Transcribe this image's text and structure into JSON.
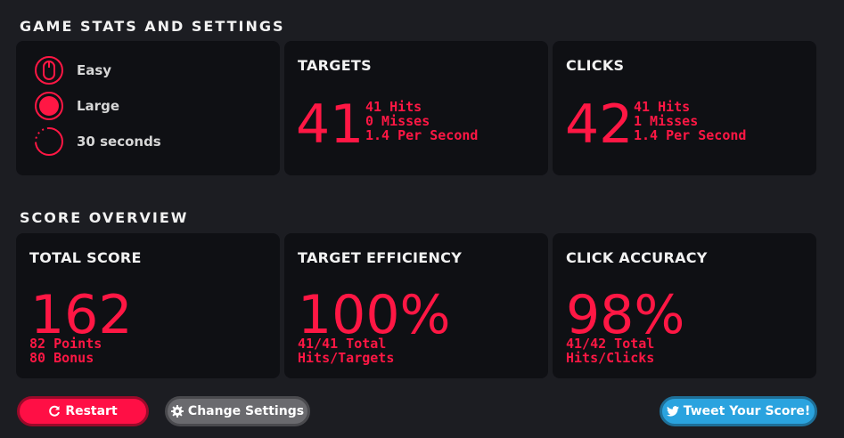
{
  "sections": {
    "stats_title": "GAME STATS AND SETTINGS",
    "overview_title": "SCORE OVERVIEW"
  },
  "settings": {
    "difficulty": "Easy",
    "size": "Large",
    "duration": "30 seconds"
  },
  "targets": {
    "title": "TARGETS",
    "value": "41",
    "hits": "41 Hits",
    "misses": "0 Misses",
    "rate": "1.4 Per Second"
  },
  "clicks": {
    "title": "CLICKS",
    "value": "42",
    "hits": "41 Hits",
    "misses": "1 Misses",
    "rate": "1.4 Per Second"
  },
  "total_score": {
    "title": "TOTAL SCORE",
    "value": "162",
    "points": "82 Points",
    "bonus": "80 Bonus"
  },
  "target_efficiency": {
    "title": "TARGET EFFICIENCY",
    "value": "100%",
    "line1": "41/41 Total",
    "line2": "Hits/Targets"
  },
  "click_accuracy": {
    "title": "CLICK ACCURACY",
    "value": "98%",
    "line1": "41/42 Total",
    "line2": "Hits/Clicks"
  },
  "buttons": {
    "restart": "Restart",
    "change_settings": "Change Settings",
    "tweet": "Tweet Your Score!"
  },
  "colors": {
    "accent": "#ff1744",
    "card_bg": "#0f1014",
    "page_bg": "#1c1d22",
    "restart_bg": "#ff0f45",
    "settings_bg": "#6a6a6e",
    "tweet_bg": "#2aa3df"
  },
  "icons": {
    "difficulty": "mouse-icon",
    "size": "target-size-icon",
    "duration": "timer-icon",
    "restart": "restart-icon",
    "settings": "gear-icon",
    "tweet": "twitter-icon"
  }
}
